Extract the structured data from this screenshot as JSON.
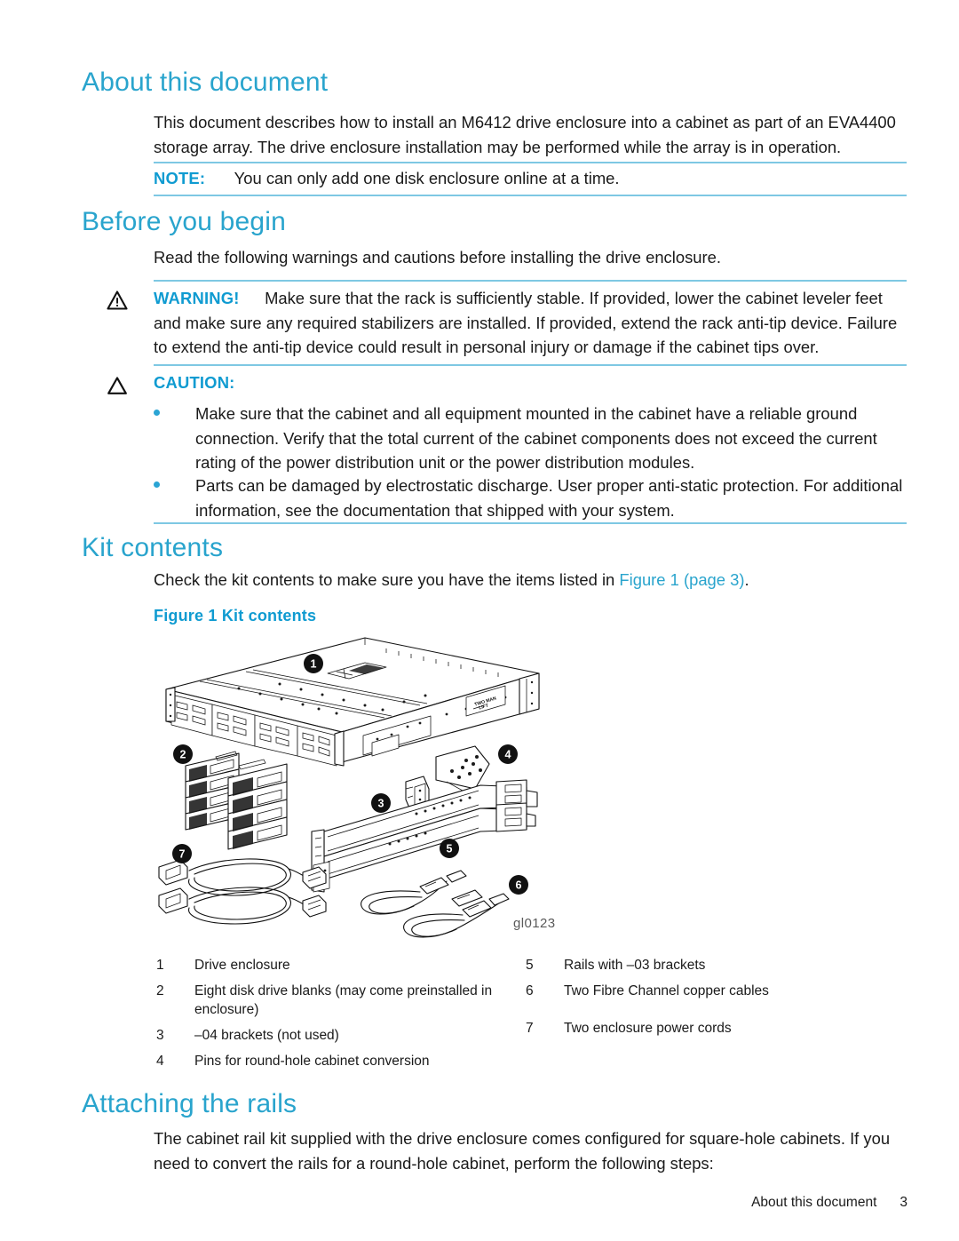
{
  "document": {
    "sections": {
      "about": {
        "heading": "About this document",
        "paragraph": "This document describes how to install an M6412 drive enclosure into a cabinet as part of an EVA4400 storage array. The drive enclosure installation may be performed while the array is in operation.",
        "note": {
          "label": "NOTE:",
          "text": "You can only add one disk enclosure online at a time."
        }
      },
      "before_you_begin": {
        "heading": "Before you begin",
        "paragraph": "Read the following warnings and cautions before installing the drive enclosure.",
        "warning": {
          "label": "WARNING!",
          "text": "Make sure that the rack is sufficiently stable. If provided, lower the cabinet leveler feet and make sure any required stabilizers are installed. If provided, extend the rack anti-tip device. Failure to extend the anti-tip device could result in personal injury or damage if the cabinet tips over."
        },
        "caution": {
          "label": "CAUTION:",
          "bullets": [
            "Make sure that the cabinet and all equipment mounted in the cabinet have a reliable ground connection. Verify that the total current of the cabinet components does not exceed the current rating of the power distribution unit or the power distribution modules.",
            "Parts can be damaged by electrostatic discharge. User proper anti-static protection. For additional information, see the documentation that shipped with your system."
          ]
        }
      },
      "kit_contents": {
        "heading": "Kit contents",
        "paragraph_before_link": "Check the kit contents to make sure you have the items listed in ",
        "link_text": "Figure 1 (page 3)",
        "paragraph_after_link": ".",
        "figure": {
          "caption": "Figure 1 Kit contents",
          "graphic_id": "gl0123",
          "enclosure_label": "TWO MAN LIFT",
          "callouts": [
            "1",
            "2",
            "3",
            "4",
            "5",
            "6",
            "7"
          ],
          "legend": [
            {
              "num": "1",
              "label": "Drive enclosure"
            },
            {
              "num": "2",
              "label": "Eight disk drive blanks (may come preinstalled in enclosure)"
            },
            {
              "num": "3",
              "label": "–04 brackets (not used)"
            },
            {
              "num": "4",
              "label": "Pins for round-hole cabinet conversion"
            },
            {
              "num": "5",
              "label": "Rails with –03 brackets"
            },
            {
              "num": "6",
              "label": "Two Fibre Channel copper cables"
            },
            {
              "num": "7",
              "label": "Two enclosure power cords"
            }
          ]
        }
      },
      "attaching_the_rails": {
        "heading": "Attaching the rails",
        "paragraph": "The cabinet rail kit supplied with the drive enclosure comes configured for square-hole cabinets. If you need to convert the rails for a round-hole cabinet, perform the following steps:"
      }
    },
    "footer": {
      "running_head": "About this document",
      "page_number": "3"
    },
    "colors": {
      "heading_blue": "#29a4cd",
      "admonition_blue": "#0f9bd1",
      "rule_blue": "#7ec8e3",
      "bullet_blue": "#2aa4d4",
      "body_text": "#1a1a1a"
    }
  }
}
